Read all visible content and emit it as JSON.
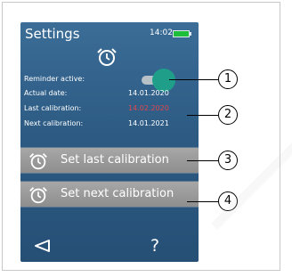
{
  "header": {
    "title": "Settings",
    "time": "14:02"
  },
  "settings": {
    "rows": [
      {
        "label": "Reminder active:",
        "value": ""
      },
      {
        "label": "Actual date:",
        "value": "14.01.2020"
      },
      {
        "label": "Last calibration:",
        "value": "14.02.2020"
      },
      {
        "label": "Next calibration:",
        "value": "14.01.2021"
      }
    ],
    "reminder_active": true
  },
  "buttons": {
    "set_last": "Set last calibration",
    "set_next": "Set next calibration"
  },
  "nav": {
    "help": "?"
  },
  "callouts": [
    "1",
    "2",
    "3",
    "4"
  ],
  "colors": {
    "screen": "#2d5b84",
    "accent": "#1f9f8a",
    "warning": "#e0474d",
    "battery": "#1cbe3a"
  }
}
